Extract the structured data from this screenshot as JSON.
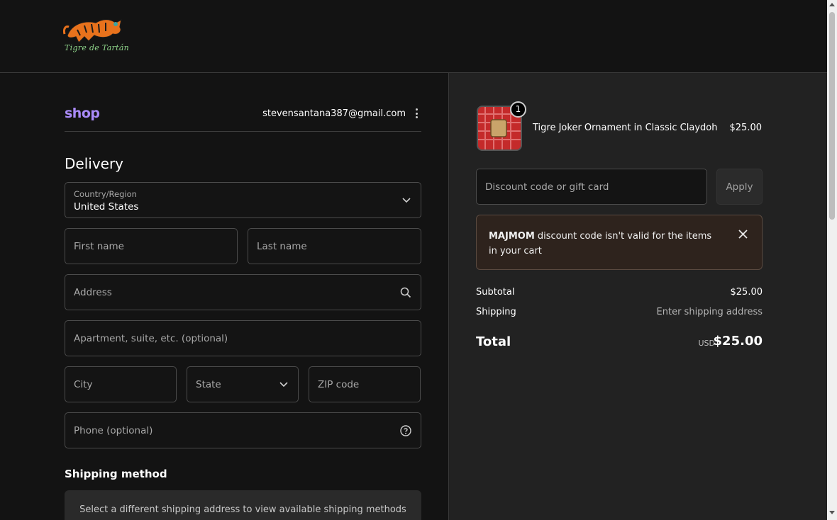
{
  "header": {
    "store_name": "Tigre de Tartán"
  },
  "account": {
    "shop_label": "shop",
    "email": "stevensantana387@gmail.com"
  },
  "delivery": {
    "title": "Delivery",
    "country_label": "Country/Region",
    "country_value": "United States",
    "first_name_placeholder": "First name",
    "last_name_placeholder": "Last name",
    "address_placeholder": "Address",
    "apartment_placeholder": "Apartment, suite, etc. (optional)",
    "city_placeholder": "City",
    "state_placeholder": "State",
    "zip_placeholder": "ZIP code",
    "phone_placeholder": "Phone (optional)"
  },
  "shipping": {
    "title": "Shipping method",
    "message": "Select a different shipping address to view available shipping methods"
  },
  "cart": {
    "item": {
      "name": "Tigre Joker Ornament in Classic Claydoh",
      "price": "$25.00",
      "quantity": "1"
    },
    "discount_placeholder": "Discount code or gift card",
    "apply_label": "Apply",
    "error_code": "MAJMOM",
    "error_text": " discount code isn't valid for the items in your cart",
    "subtotal_label": "Subtotal",
    "subtotal_value": "$25.00",
    "shipping_label": "Shipping",
    "shipping_value": "Enter shipping address",
    "total_label": "Total",
    "total_currency": "USD",
    "total_value": "$25.00"
  },
  "colors": {
    "shop_brand": "#a98af7",
    "background": "#131313",
    "summary_bg": "#222222",
    "error_bg": "#2e231d"
  }
}
